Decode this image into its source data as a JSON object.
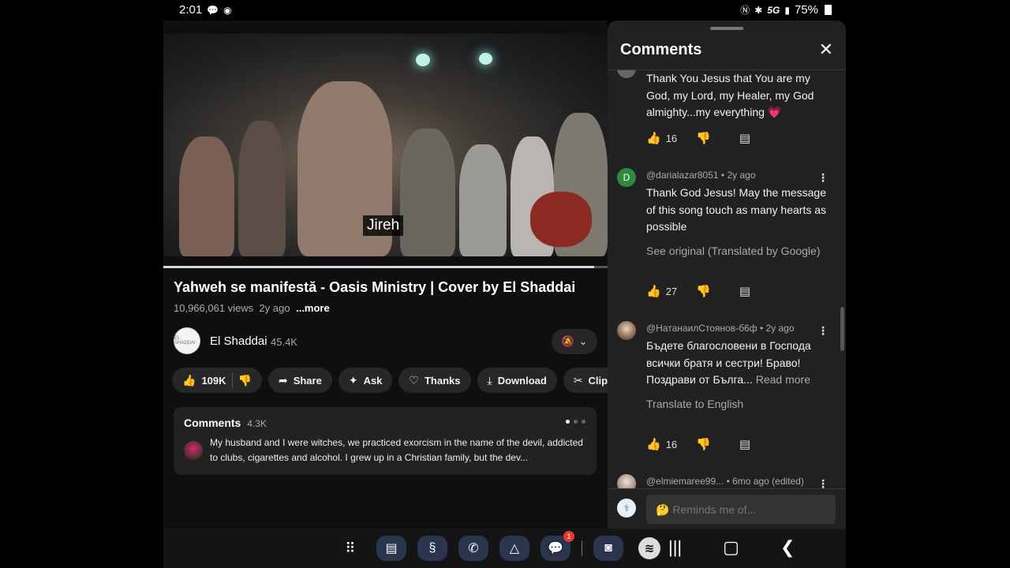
{
  "status_bar": {
    "time": "2:01",
    "left_icons": [
      "chat-bubble-icon",
      "circle-status-icon"
    ],
    "right_icons": [
      "nfc-icon",
      "bluetooth-icon",
      "5g-icon",
      "signal-icon"
    ],
    "network": "5G",
    "battery": "75%"
  },
  "video": {
    "caption": "Jireh",
    "progress": 0.97
  },
  "video_info": {
    "title": "Yahweh se manifestă - Oasis Ministry | Cover by El Shaddai",
    "views": "10,966,061 views",
    "age": "2y ago",
    "more": "...more"
  },
  "channel": {
    "avatar_text": "EL SHADDAI",
    "name": "El Shaddai",
    "subscribers": "45.4K"
  },
  "actions": {
    "likes": "109K",
    "share": "Share",
    "ask": "Ask",
    "thanks": "Thanks",
    "download": "Download",
    "clip": "Clip"
  },
  "comments_preview": {
    "title": "Comments",
    "count": "4.3K",
    "text": "My husband and I were witches, we practiced exorcism in the name of the devil, addicted to clubs, cigarettes and alcohol. I grew up in a Christian family, but the dev..."
  },
  "panel": {
    "title": "Comments",
    "comments": [
      {
        "author": "",
        "meta": "",
        "body": "Thank You Jesus that You are my God, my Lord, my Healer, my God almighty...my everything 💗",
        "extra": "",
        "likes": "16"
      },
      {
        "author": "@darialazar8051",
        "meta": "• 2y ago",
        "avatar_letter": "D",
        "body": "Thank God Jesus! May the message of this song touch as many hearts as possible",
        "extra": "See original (Translated by Google)",
        "likes": "27"
      },
      {
        "author": "@НатанаилСтоянов-б6ф",
        "meta": "• 2y ago",
        "body": "Бъдете благословени в Господа всички братя и сестри! Браво! Поздрави от Бълга...",
        "read_more": "Read more",
        "extra": "Translate to English",
        "likes": "16"
      },
      {
        "author": "@elmiemaree99...",
        "meta": "• 6mo ago (edited)",
        "body": "",
        "extra": "",
        "likes": ""
      }
    ],
    "reply_placeholder": "🤔 Reminds me of..."
  },
  "colors": {
    "app_background": "#0f0f0f",
    "panel_background": "#212121",
    "pill_background": "#272727",
    "avatar_green": "#2e8b3e",
    "badge_red": "#e53935"
  },
  "navbar": {
    "apps": [
      "apps-grid-icon",
      "docs-icon",
      "shazam-icon",
      "phone-icon",
      "drive-icon",
      "messages-icon",
      "camera-icon",
      "spotify-icon"
    ],
    "messages_badge": "1",
    "system": [
      "recents-icon",
      "home-icon",
      "back-icon"
    ]
  }
}
